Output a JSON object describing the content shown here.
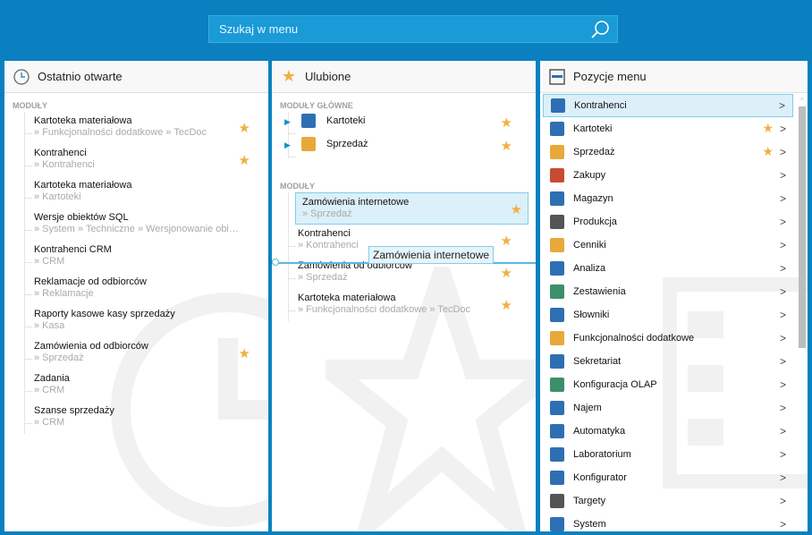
{
  "search": {
    "placeholder": "Szukaj w menu"
  },
  "recent": {
    "title": "Ostatnio otwarte",
    "section": "MODUŁY",
    "items": [
      {
        "title": "Kartoteka materiałowa",
        "path": "» Funkcjonalności dodatkowe » TecDoc",
        "fav": true
      },
      {
        "title": "Kontrahenci",
        "path": "» Kontrahenci",
        "fav": true
      },
      {
        "title": "Kartoteka materiałowa",
        "path": "» Kartoteki",
        "fav": false
      },
      {
        "title": "Wersje obiektów SQL",
        "path": "» System » Techniczne » Wersjonowanie obie…",
        "fav": false
      },
      {
        "title": "Kontrahenci CRM",
        "path": "» CRM",
        "fav": false
      },
      {
        "title": "Reklamacje od odbiorców",
        "path": "» Reklamacje",
        "fav": false
      },
      {
        "title": "Raporty kasowe kasy sprzedaży",
        "path": "» Kasa",
        "fav": false
      },
      {
        "title": "Zamówienia od odbiorców",
        "path": "» Sprzedaż",
        "fav": true
      },
      {
        "title": "Zadania",
        "path": "» CRM",
        "fav": false
      },
      {
        "title": "Szanse sprzedaży",
        "path": "» CRM",
        "fav": false
      }
    ]
  },
  "favorites": {
    "title": "Ulubione",
    "main_section": "MODUŁY GŁÓWNE",
    "main_items": [
      {
        "title": "Kartoteki"
      },
      {
        "title": "Sprzedaż"
      }
    ],
    "section": "MODUŁY",
    "items": [
      {
        "title": "Zamówienia internetowe",
        "path": "» Sprzedaż"
      },
      {
        "title": "Kontrahenci",
        "path": "» Kontrahenci"
      },
      {
        "title": "Zamówienia od odbiorców",
        "path": "» Sprzedaż"
      },
      {
        "title": "Kartoteka materiałowa",
        "path": "» Funkcjonalności dodatkowe » TecDoc"
      }
    ],
    "drag_tooltip": "Zamówienia internetowe"
  },
  "menu": {
    "title": "Pozycje menu",
    "items": [
      {
        "label": "Kontrahenci",
        "fav": false,
        "color": "#2e6fb4"
      },
      {
        "label": "Kartoteki",
        "fav": true,
        "color": "#2e6fb4"
      },
      {
        "label": "Sprzedaż",
        "fav": true,
        "color": "#e8a93a"
      },
      {
        "label": "Zakupy",
        "fav": false,
        "color": "#c94a32"
      },
      {
        "label": "Magazyn",
        "fav": false,
        "color": "#2e6fb4"
      },
      {
        "label": "Produkcja",
        "fav": false,
        "color": "#555"
      },
      {
        "label": "Cenniki",
        "fav": false,
        "color": "#e8a93a"
      },
      {
        "label": "Analiza",
        "fav": false,
        "color": "#2e6fb4"
      },
      {
        "label": "Zestawienia",
        "fav": false,
        "color": "#3c8f6a"
      },
      {
        "label": "Słowniki",
        "fav": false,
        "color": "#2e6fb4"
      },
      {
        "label": "Funkcjonalności dodatkowe",
        "fav": false,
        "color": "#e8a93a"
      },
      {
        "label": "Sekretariat",
        "fav": false,
        "color": "#2e6fb4"
      },
      {
        "label": "Konfiguracja OLAP",
        "fav": false,
        "color": "#3c8f6a"
      },
      {
        "label": "Najem",
        "fav": false,
        "color": "#2e6fb4"
      },
      {
        "label": "Automatyka",
        "fav": false,
        "color": "#2e6fb4"
      },
      {
        "label": "Laboratorium",
        "fav": false,
        "color": "#2e6fb4"
      },
      {
        "label": "Konfigurator",
        "fav": false,
        "color": "#2e6fb4"
      },
      {
        "label": "Targety",
        "fav": false,
        "color": "#555"
      },
      {
        "label": "System",
        "fav": false,
        "color": "#2e6fb4"
      }
    ]
  }
}
